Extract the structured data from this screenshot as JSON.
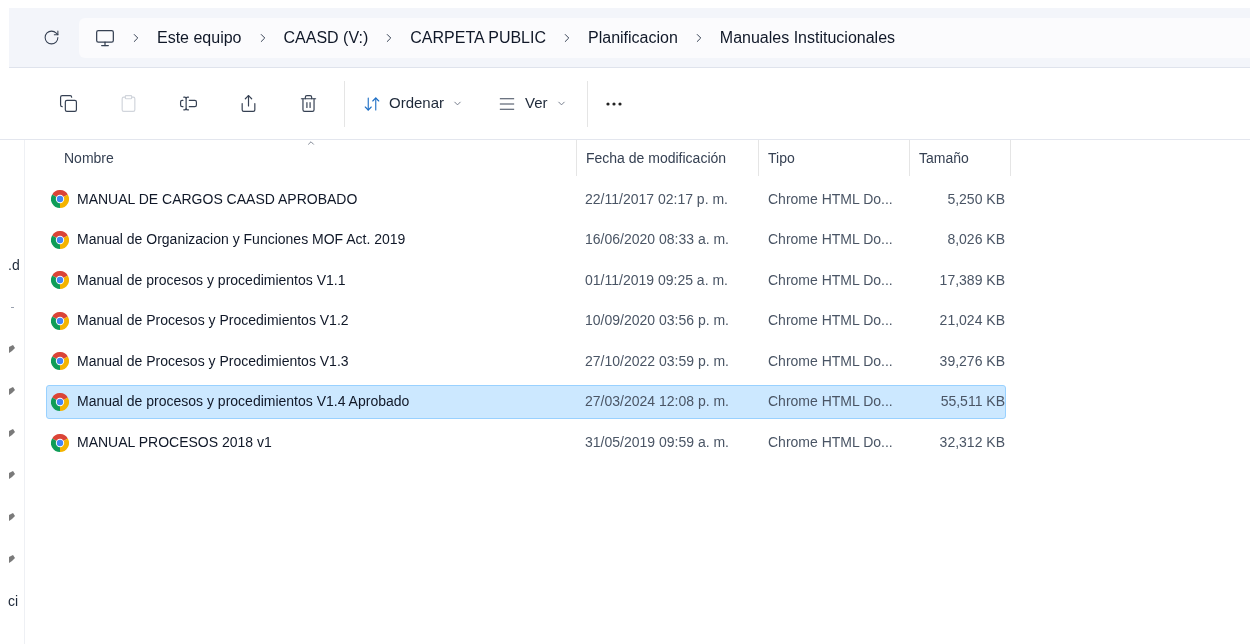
{
  "breadcrumb": [
    "Este equipo",
    "CAASD (V:)",
    "CARPETA PUBLIC",
    "Planificacion",
    "Manuales Institucionales"
  ],
  "toolbar": {
    "paste_disabled": true,
    "sort_label": "Ordenar",
    "view_label": "Ver"
  },
  "sidebar": [
    {
      "kind": "text",
      "text": ".d"
    },
    {
      "kind": "dash"
    },
    {
      "kind": "pin"
    },
    {
      "kind": "pin"
    },
    {
      "kind": "pin"
    },
    {
      "kind": "pin"
    },
    {
      "kind": "pin"
    },
    {
      "kind": "pin"
    },
    {
      "kind": "text",
      "text": "ci"
    }
  ],
  "columns": [
    {
      "label": "Nombre",
      "sorted": true
    },
    {
      "label": "Fecha de modificación",
      "sorted": false
    },
    {
      "label": "Tipo",
      "sorted": false
    },
    {
      "label": "Tamaño",
      "sorted": false
    }
  ],
  "rows": [
    {
      "name": "MANUAL DE CARGOS CAASD APROBADO",
      "date": "22/11/2017 02:17 p. m.",
      "type": "Chrome HTML Do...",
      "size": "5,250 KB",
      "selected": false
    },
    {
      "name": "Manual de Organizacion y Funciones MOF Act. 2019",
      "date": "16/06/2020 08:33 a. m.",
      "type": "Chrome HTML Do...",
      "size": "8,026 KB",
      "selected": false
    },
    {
      "name": "Manual de procesos y procedimientos V1.1",
      "date": "01/11/2019 09:25 a. m.",
      "type": "Chrome HTML Do...",
      "size": "17,389 KB",
      "selected": false
    },
    {
      "name": "Manual de Procesos y Procedimientos V1.2",
      "date": "10/09/2020 03:56 p. m.",
      "type": "Chrome HTML Do...",
      "size": "21,024 KB",
      "selected": false
    },
    {
      "name": "Manual de Procesos y Procedimientos V1.3",
      "date": "27/10/2022 03:59 p. m.",
      "type": "Chrome HTML Do...",
      "size": "39,276 KB",
      "selected": false
    },
    {
      "name": "Manual de procesos y procedimientos V1.4 Aprobado",
      "date": "27/03/2024 12:08 p. m.",
      "type": "Chrome HTML Do...",
      "size": "55,511 KB",
      "selected": true
    },
    {
      "name": "MANUAL PROCESOS 2018 v1",
      "date": "31/05/2019 09:59 a. m.",
      "type": "Chrome HTML Do...",
      "size": "32,312 KB",
      "selected": false
    }
  ]
}
